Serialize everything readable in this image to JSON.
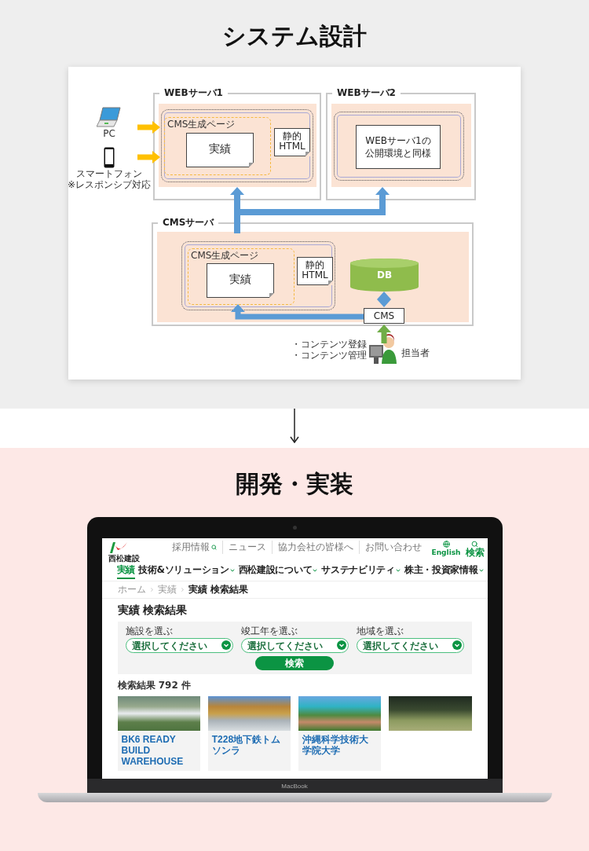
{
  "design": {
    "heading": "システム設計",
    "diagram": {
      "clients": [
        {
          "kind": "pc",
          "label": "PC"
        },
        {
          "kind": "phone",
          "label": "スマートフォン",
          "note": "※レスポンシブ対応"
        }
      ],
      "web_server_1": {
        "title": "WEBサーバ1",
        "page_label": "CMS生成ページ",
        "document": "実績",
        "static_html": [
          "静的",
          "HTML"
        ]
      },
      "web_server_2": {
        "title": "WEBサーバ2",
        "lines": [
          "WEBサーバ1の",
          "公開環境と同様"
        ]
      },
      "cms_server": {
        "title": "CMSサーバ",
        "page_label": "CMS生成ページ",
        "document": "実績",
        "static_html": [
          "静的",
          "HTML"
        ],
        "database": "DB",
        "cms": "CMS"
      },
      "operator": {
        "tasks": [
          "・コンテンツ登録",
          "・コンテンツ管理"
        ],
        "label": "担当者"
      }
    }
  },
  "implementation": {
    "heading": "開発・実装",
    "device_label": "MacBook"
  },
  "site": {
    "logo_text": "西松建設",
    "utility_links": [
      {
        "label": "採用情報",
        "icon": true
      },
      {
        "label": "ニュース",
        "icon": false
      },
      {
        "label": "協力会社の皆様へ",
        "icon": false
      },
      {
        "label": "お問い合わせ",
        "icon": false
      }
    ],
    "nav": [
      {
        "label": "実績",
        "selected": true,
        "dropdown": false
      },
      {
        "label": "技術&ソリューション",
        "selected": false,
        "dropdown": true
      },
      {
        "label": "西松建設について",
        "selected": false,
        "dropdown": true
      },
      {
        "label": "サステナビリティ",
        "selected": false,
        "dropdown": true
      },
      {
        "label": "株主・投資家情報",
        "selected": false,
        "dropdown": true
      }
    ],
    "nav_icons": [
      {
        "kind": "globe",
        "label": "English"
      },
      {
        "kind": "search",
        "label": "検索"
      }
    ],
    "breadcrumb": [
      "ホーム",
      "実績",
      "実績 検索結果"
    ],
    "page_title": "実績 検索結果",
    "filters": [
      {
        "label": "施設を選ぶ",
        "placeholder": "選択してください"
      },
      {
        "label": "竣工年を選ぶ",
        "placeholder": "選択してください"
      },
      {
        "label": "地域を選ぶ",
        "placeholder": "選択してください"
      }
    ],
    "search_button": "検索",
    "result_count": "検索結果 792 件",
    "results": [
      {
        "kind": "titled",
        "title": "BK6 READY BUILD WAREHOUSE"
      },
      {
        "kind": "titled",
        "title": "T228地下鉄トムソンラ"
      },
      {
        "kind": "titled",
        "title": "沖縄科学技術大学院大学"
      },
      {
        "kind": "photo_only"
      }
    ]
  }
}
